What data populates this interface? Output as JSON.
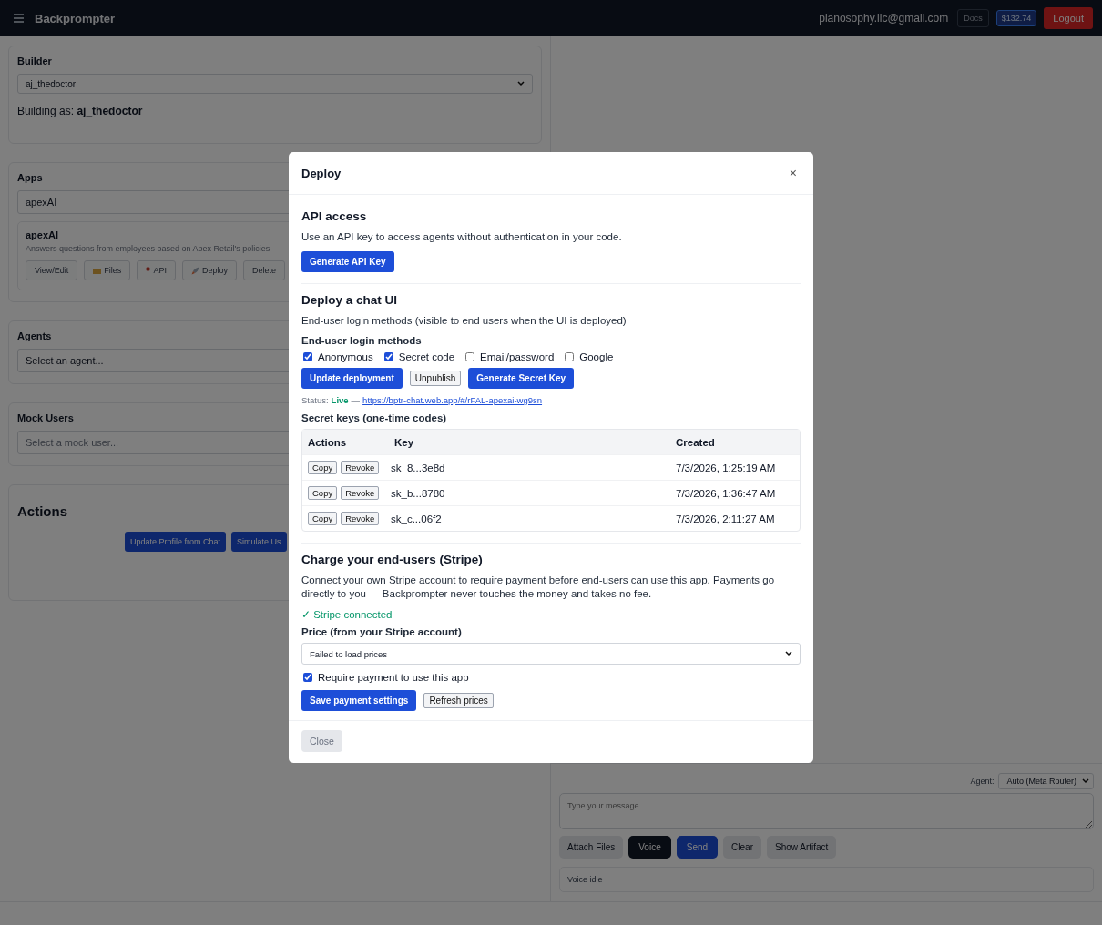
{
  "header": {
    "brand": "Backprompter",
    "email": "planosophy.llc@gmail.com",
    "docs": "Docs",
    "balance": "$132.74",
    "logout": "Logout"
  },
  "builder": {
    "title": "Builder",
    "select": "aj_thedoctor",
    "building_as": "Building as: **aj_thedoctor**"
  },
  "apps": {
    "title": "Apps",
    "search": "apexAI",
    "app": {
      "name": "apexAI",
      "description": "Answers questions from employees based on Apex Retail's policies",
      "buttons": [
        {
          "label": "View/Edit"
        },
        {
          "label": "Files"
        },
        {
          "label": "API"
        },
        {
          "label": "Deploy"
        },
        {
          "label": "Delete"
        }
      ]
    }
  },
  "agents": {
    "title": "Agents",
    "select": "Select an agent..."
  },
  "mock_users": {
    "title": "Mock Users",
    "select": "Select a mock user..."
  },
  "actions": {
    "title": "Actions",
    "buttons": [
      "Update Profile from Chat",
      "Simulate Us"
    ]
  },
  "chat": {
    "agent_label": "Agent:",
    "agent_select": "Auto (Meta Router)",
    "placeholder": "Type your message...",
    "buttons": [
      {
        "label": "Attach Files",
        "kind": "default"
      },
      {
        "label": "Voice",
        "kind": "dark"
      },
      {
        "label": "Send",
        "kind": "primary"
      },
      {
        "label": "Clear",
        "kind": "default"
      },
      {
        "label": "Show Artifact",
        "kind": "default"
      }
    ],
    "status": "Voice idle"
  },
  "modal": {
    "title": "Deploy",
    "close": "×",
    "api": {
      "heading": "API access",
      "text": "Use an API key to access agents without authentication in your code.",
      "button": "Generate API Key"
    },
    "chat_ui": {
      "heading": "Deploy a chat UI",
      "text": "End-user login methods (visible to end users when the UI is deployed)",
      "methods_label": "End-user login methods",
      "methods": [
        {
          "label": "Anonymous",
          "checked": true
        },
        {
          "label": "Secret code",
          "checked": true
        },
        {
          "label": "Email/password",
          "checked": false
        },
        {
          "label": "Google",
          "checked": false
        }
      ],
      "buttons": [
        {
          "label": "Update deployment",
          "kind": "primary"
        },
        {
          "label": "Unpublish",
          "kind": "plain"
        },
        {
          "label": "Generate Secret Key",
          "kind": "primary"
        }
      ],
      "status": {
        "label": "Status:",
        "value": "Live",
        "separator": "—",
        "url": "https://bptr-chat.web.app/#/rFAL-apexai-wg9sn"
      }
    },
    "secret_keys": {
      "title": "Secret keys (one-time codes)",
      "columns": [
        "Actions",
        "Key",
        "Created"
      ],
      "rows": [
        {
          "actions": [
            "Copy",
            "Revoke"
          ],
          "key": "sk_8...3e8d",
          "created": "7/3/2026, 1:25:19 AM"
        },
        {
          "actions": [
            "Copy",
            "Revoke"
          ],
          "key": "sk_b...8780",
          "created": "7/3/2026, 1:36:47 AM"
        },
        {
          "actions": [
            "Copy",
            "Revoke"
          ],
          "key": "sk_c...06f2",
          "created": "7/3/2026, 2:11:27 AM"
        }
      ]
    },
    "stripe": {
      "heading": "Charge your end-users (Stripe)",
      "text": "Connect your own Stripe account to require payment before end-users can use this app. Payments go directly to you — Backprompter never touches the money and takes no fee.",
      "connected": "✓ Stripe connected",
      "price_label": "Price (from your Stripe account)",
      "price_select": "Failed to load prices",
      "require": {
        "label": "Require payment to use this app",
        "checked": true
      },
      "buttons": [
        {
          "label": "Save payment settings",
          "kind": "primary"
        },
        {
          "label": "Refresh prices",
          "kind": "plain"
        }
      ]
    },
    "footer_button": "Close"
  }
}
